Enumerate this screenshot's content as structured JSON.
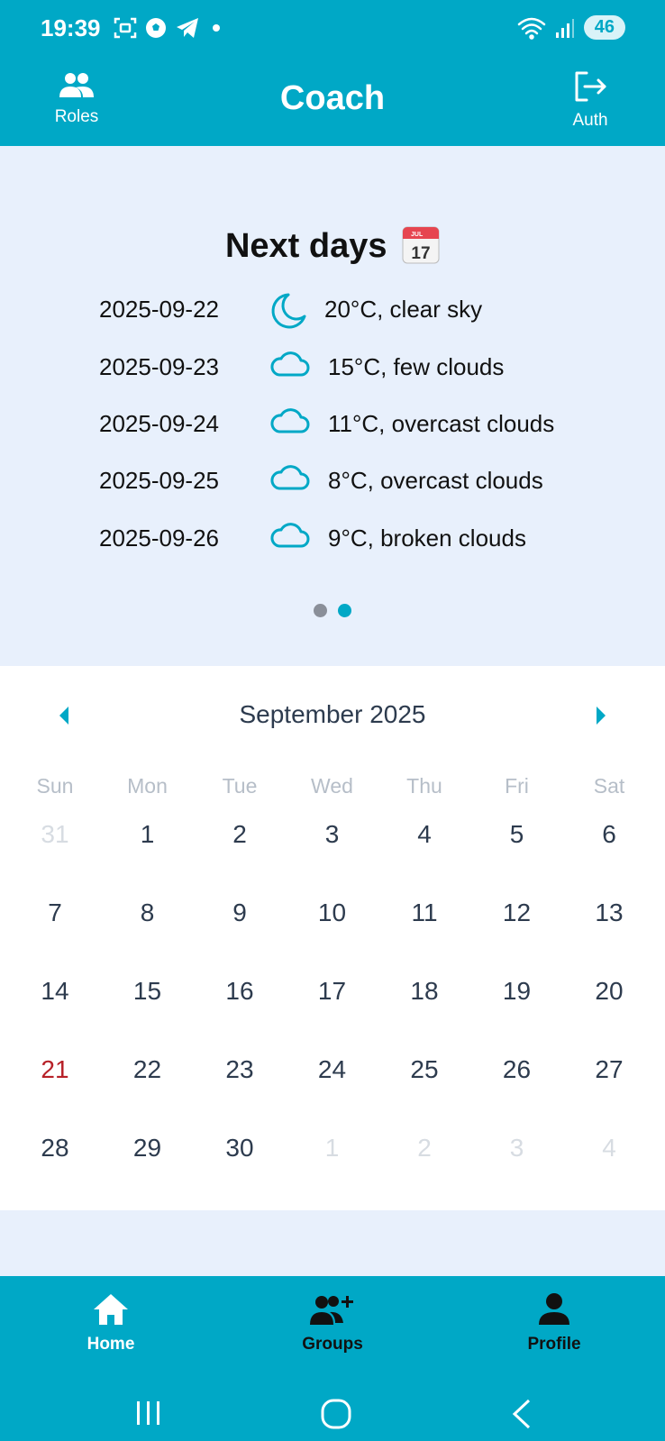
{
  "status_bar": {
    "time": "19:39",
    "battery": "46",
    "left_icons": [
      "screenshot-icon",
      "football-icon",
      "telegram-icon",
      "dot-icon"
    ],
    "right_icons": [
      "wifi-icon",
      "signal-icon"
    ]
  },
  "app_bar": {
    "title": "Coach",
    "left_button": {
      "label": "Roles",
      "icon": "people-icon"
    },
    "right_button": {
      "label": "Auth",
      "icon": "logout-icon"
    }
  },
  "weather": {
    "title": "Next days",
    "title_icon": "calendar-emoji-icon",
    "rows": [
      {
        "date": "2025-09-22",
        "icon": "moon-icon",
        "text": "20°C, clear sky"
      },
      {
        "date": "2025-09-23",
        "icon": "cloud-icon",
        "text": "15°C, few clouds"
      },
      {
        "date": "2025-09-24",
        "icon": "cloud-icon",
        "text": "11°C, overcast clouds"
      },
      {
        "date": "2025-09-25",
        "icon": "cloud-icon",
        "text": "8°C, overcast clouds"
      },
      {
        "date": "2025-09-26",
        "icon": "cloud-icon",
        "text": "9°C, broken clouds"
      }
    ],
    "pager": {
      "count": 2,
      "active": 2
    }
  },
  "calendar": {
    "month_label": "September 2025",
    "weekdays": [
      "Sun",
      "Mon",
      "Tue",
      "Wed",
      "Thu",
      "Fri",
      "Sat"
    ],
    "weeks": [
      [
        "31",
        "1",
        "2",
        "3",
        "4",
        "5",
        "6"
      ],
      [
        "7",
        "8",
        "9",
        "10",
        "11",
        "12",
        "13"
      ],
      [
        "14",
        "15",
        "16",
        "17",
        "18",
        "19",
        "20"
      ],
      [
        "21",
        "22",
        "23",
        "24",
        "25",
        "26",
        "27"
      ],
      [
        "28",
        "29",
        "30",
        "1",
        "2",
        "3",
        "4"
      ]
    ],
    "today": "21"
  },
  "bottom_nav": {
    "items": [
      {
        "label": "Home",
        "icon": "home-icon",
        "active": true
      },
      {
        "label": "Groups",
        "icon": "add-group-icon",
        "active": false
      },
      {
        "label": "Profile",
        "icon": "person-icon",
        "active": false
      }
    ]
  },
  "colors": {
    "primary": "#00a8c6",
    "background": "#e8f0fc",
    "today": "#b72128",
    "text_dark": "#2d3b4e",
    "dot_inactive": "#8a8f99"
  }
}
